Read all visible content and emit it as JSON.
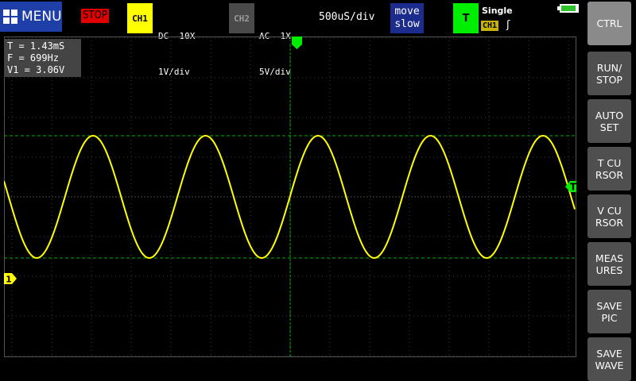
{
  "header": {
    "menu_label": "MENU",
    "run_state": "STOP",
    "ch1": {
      "badge": "CH1",
      "coupling": "DC  10X",
      "scale": "1V/div",
      "color": "#ffff00"
    },
    "ch2": {
      "badge": "CH2",
      "coupling": "AC  1X",
      "scale": "5V/div",
      "color": "#4a4a4a"
    },
    "timebase": "500uS/div",
    "move": {
      "line1": "move",
      "line2": "slow"
    },
    "trigger": {
      "badge": "T",
      "mode": "Single",
      "source": "CH1",
      "edge": "ʃ"
    }
  },
  "measurements": {
    "period": "T = 1.43mS",
    "frequency": "F = 699Hz",
    "voltage": "V1 = 3.06V"
  },
  "markers": {
    "ch1_ground": "1",
    "trigger_level": "T"
  },
  "side_buttons": [
    {
      "label": "CTRL",
      "active": true
    },
    {
      "label": "RUN/\nSTOP",
      "active": false
    },
    {
      "label": "AUTO\nSET",
      "active": false
    },
    {
      "label": "T CU\nRSOR",
      "active": false
    },
    {
      "label": "V CU\nRSOR",
      "active": false
    },
    {
      "label": "MEAS\nURES",
      "active": false
    },
    {
      "label": "SAVE\nPIC",
      "active": false
    },
    {
      "label": "SAVE\nWAVE",
      "active": false
    }
  ],
  "colors": {
    "trace_ch1": "#ffff00",
    "trigger": "#00ee00",
    "cursor_lines": "#00b000",
    "grid": "#3a3a3a"
  },
  "waveform": {
    "type": "sine",
    "channel": "CH1",
    "cycles_shown": 5,
    "volts_per_div": 1,
    "time_per_div_us": 500
  }
}
